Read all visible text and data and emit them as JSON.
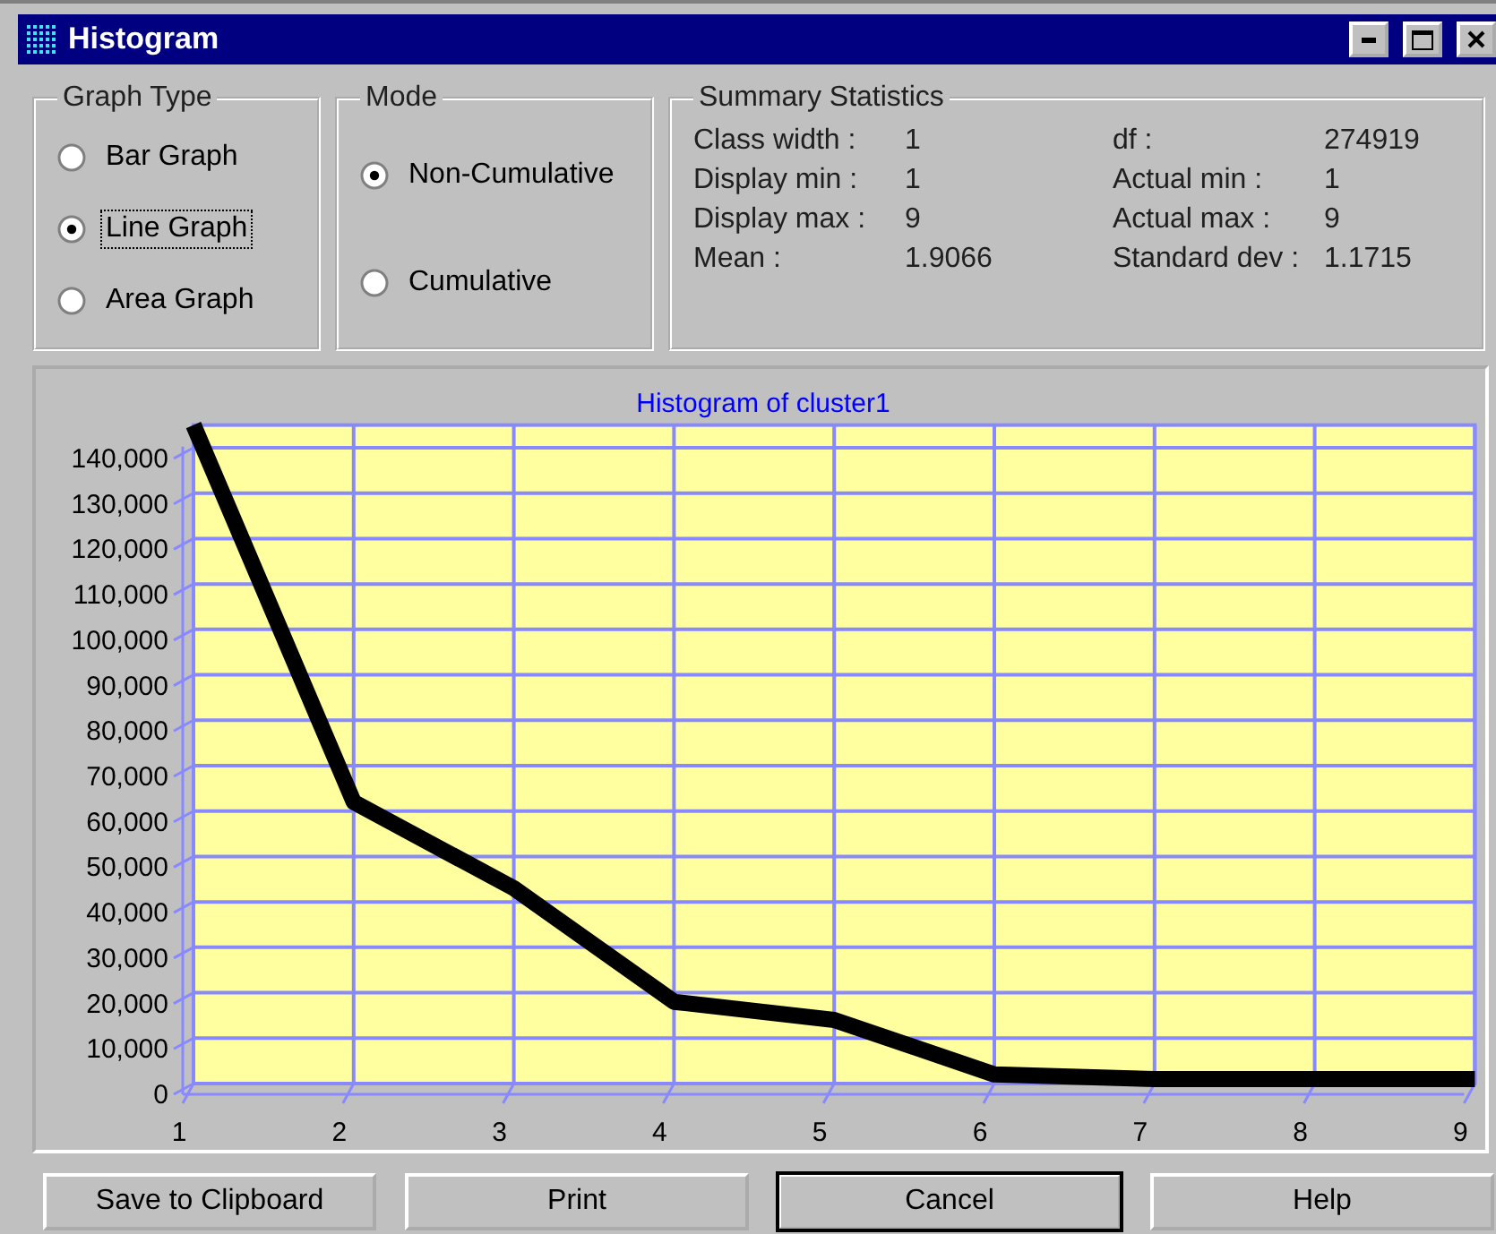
{
  "window": {
    "title": "Histogram"
  },
  "graph_type": {
    "legend": "Graph Type",
    "options": [
      {
        "label": "Bar Graph",
        "selected": false,
        "focused": false
      },
      {
        "label": "Line Graph",
        "selected": true,
        "focused": true
      },
      {
        "label": "Area Graph",
        "selected": false,
        "focused": false
      }
    ]
  },
  "mode": {
    "legend": "Mode",
    "options": [
      {
        "label": "Non-Cumulative",
        "selected": true
      },
      {
        "label": "Cumulative",
        "selected": false
      }
    ]
  },
  "summary": {
    "legend": "Summary Statistics",
    "rows": [
      {
        "label": "Class width :",
        "value": "1",
        "label_2": "df :",
        "value_2": "274919"
      },
      {
        "label": "Display min :",
        "value": "1",
        "label_2": "Actual min :",
        "value_2": "1"
      },
      {
        "label": "Display max :",
        "value": "9",
        "label_2": "Actual max :",
        "value_2": "9"
      },
      {
        "label": "Mean :",
        "value": "1.9066",
        "label_2": "Standard dev :",
        "value_2": "1.1715"
      }
    ]
  },
  "chart": {
    "chart_data": {
      "type": "line",
      "title": "Histogram of cluster1",
      "categories": [
        "1",
        "2",
        "3",
        "4",
        "5",
        "6",
        "7",
        "8",
        "9"
      ],
      "ylim": [
        0,
        145000
      ],
      "grid": true,
      "series": [
        {
          "color": "#000000",
          "values": [
            145000,
            62000,
            43000,
            18000,
            14000,
            2000,
            1000,
            1000,
            1000
          ]
        }
      ],
      "yticks": [
        {
          "value": 0,
          "label": "0"
        },
        {
          "value": 10000,
          "label": "10,000"
        },
        {
          "value": 20000,
          "label": "20,000"
        },
        {
          "value": 30000,
          "label": "30,000"
        },
        {
          "value": 40000,
          "label": "40,000"
        },
        {
          "value": 50000,
          "label": "50,000"
        },
        {
          "value": 60000,
          "label": "60,000"
        },
        {
          "value": 70000,
          "label": "70,000"
        },
        {
          "value": 80000,
          "label": "80,000"
        },
        {
          "value": 90000,
          "label": "90,000"
        },
        {
          "value": 100000,
          "label": "100,000"
        },
        {
          "value": 110000,
          "label": "110,000"
        },
        {
          "value": 120000,
          "label": "120,000"
        },
        {
          "value": 130000,
          "label": "130,000"
        },
        {
          "value": 140000,
          "label": "140,000"
        }
      ]
    }
  },
  "buttons": [
    {
      "label": "Save to Clipboard",
      "default": false
    },
    {
      "label": "Print",
      "default": false
    },
    {
      "label": "Cancel",
      "default": true
    },
    {
      "label": "Help",
      "default": false
    }
  ]
}
